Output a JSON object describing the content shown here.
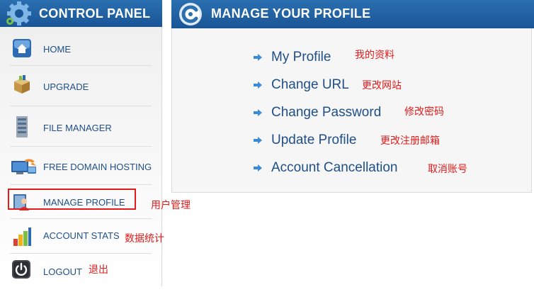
{
  "left_panel": {
    "title": "CONTROL PANEL",
    "items": [
      {
        "label": "HOME",
        "icon": "home-icon"
      },
      {
        "label": "UPGRADE",
        "icon": "box-icon"
      },
      {
        "label": "FILE MANAGER",
        "icon": "server-icon"
      },
      {
        "label": "FREE DOMAIN HOSTING",
        "icon": "domain-hosting-icon"
      },
      {
        "label": "MANAGE PROFILE",
        "icon": "user-profile-icon"
      },
      {
        "label": "ACCOUNT STATS",
        "icon": "bar-chart-icon"
      },
      {
        "label": "LOGOUT",
        "icon": "power-icon"
      }
    ]
  },
  "right_panel": {
    "title": "MANAGE YOUR PROFILE",
    "links": [
      {
        "label": "My Profile",
        "note": "我的资料"
      },
      {
        "label": "Change URL",
        "note": "更改网站"
      },
      {
        "label": "Change Password",
        "note": "修改密码"
      },
      {
        "label": "Update Profile",
        "note": "更改注册邮箱"
      },
      {
        "label": "Account Cancellation",
        "note": "取消账号"
      }
    ]
  },
  "annotations": {
    "manage_profile": "用户管理",
    "account_stats": "数据统计",
    "logout": "退出"
  },
  "colors": {
    "header_blue": "#1a5596",
    "link_blue": "#1f4f86",
    "annotation_red": "#e21b1b",
    "arrow_blue": "#3a8ad6"
  }
}
